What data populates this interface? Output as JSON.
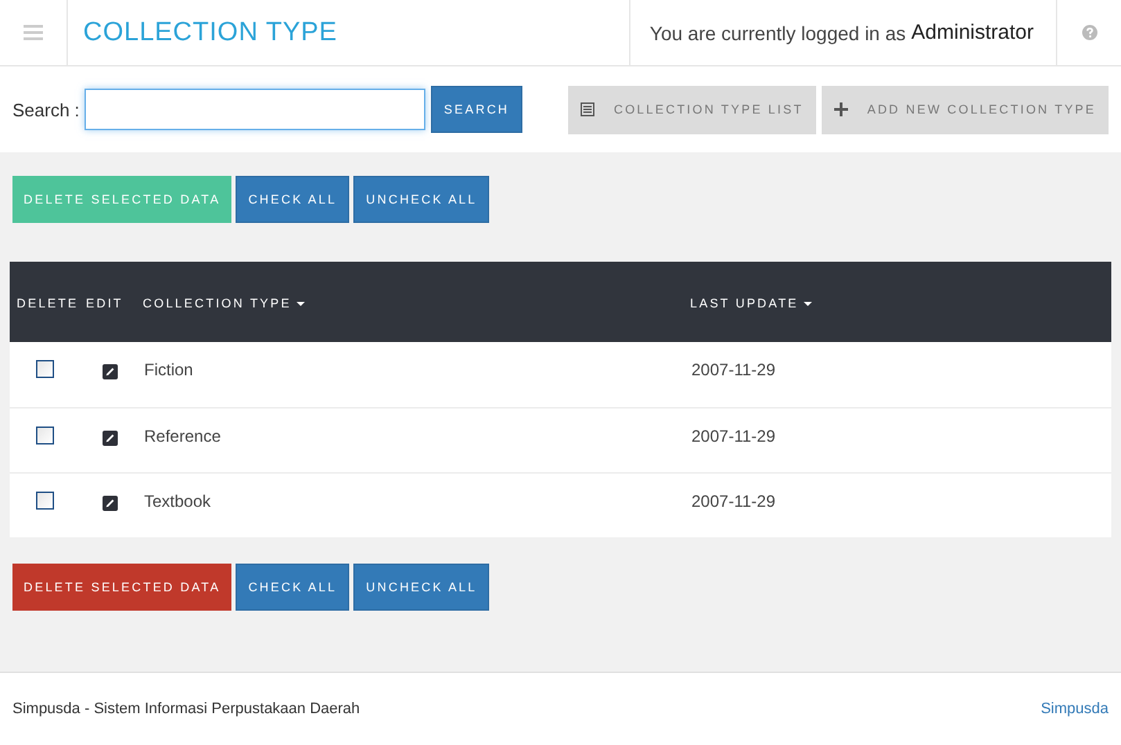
{
  "header": {
    "title": "COLLECTION TYPE",
    "login_text": "You are currently logged in as",
    "user": "Administrator"
  },
  "search": {
    "label": "Search :",
    "button": "SEARCH"
  },
  "nav_buttons": [
    {
      "kind": "list",
      "label": "COLLECTION TYPE LIST"
    },
    {
      "kind": "add",
      "label": "ADD NEW COLLECTION TYPE"
    }
  ],
  "top_actions": [
    {
      "kind": "success",
      "label": "DELETE SELECTED DATA"
    },
    {
      "kind": "primary",
      "label": "CHECK ALL"
    },
    {
      "kind": "primary",
      "label": "UNCHECK ALL"
    }
  ],
  "table": {
    "columns": [
      {
        "label": "DELETE",
        "sortable": false
      },
      {
        "label": "EDIT",
        "sortable": false
      },
      {
        "label": "COLLECTION TYPE",
        "sortable": true
      },
      {
        "label": "LAST UPDATE",
        "sortable": true
      }
    ],
    "rows": [
      {
        "checked": false,
        "name": "Fiction",
        "last_update": "2007-11-29"
      },
      {
        "checked": false,
        "name": "Reference",
        "last_update": "2007-11-29"
      },
      {
        "checked": false,
        "name": "Textbook",
        "last_update": "2007-11-29"
      }
    ]
  },
  "bottom_actions": [
    {
      "kind": "danger",
      "label": "DELETE SELECTED DATA"
    },
    {
      "kind": "primary",
      "label": "CHECK ALL"
    },
    {
      "kind": "primary",
      "label": "UNCHECK ALL"
    }
  ],
  "footer": {
    "text": "Simpusda - Sistem Informasi Perpustakaan Daerah",
    "link": "Simpusda"
  }
}
